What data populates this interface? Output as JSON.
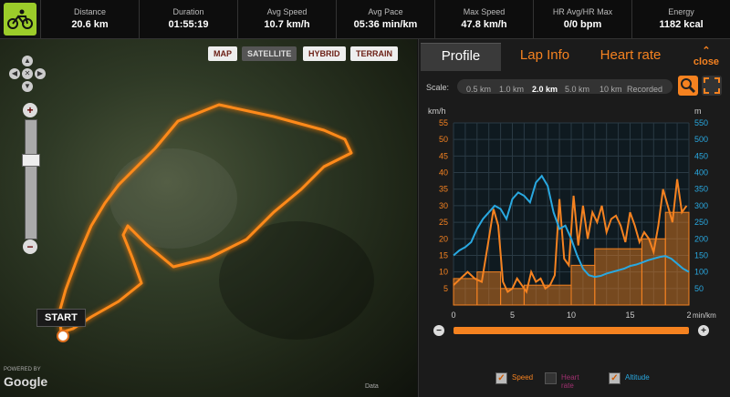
{
  "stats": [
    {
      "label": "Distance",
      "value": "20.6 km"
    },
    {
      "label": "Duration",
      "value": "01:55:19"
    },
    {
      "label": "Avg Speed",
      "value": "10.7 km/h"
    },
    {
      "label": "Avg Pace",
      "value": "05:36 min/km"
    },
    {
      "label": "Max Speed",
      "value": "47.8 km/h"
    },
    {
      "label": "HR Avg/HR Max",
      "value": "0/0 bpm"
    },
    {
      "label": "Energy",
      "value": "1182 kcal"
    }
  ],
  "map": {
    "types": [
      "MAP",
      "SATELLITE",
      "HYBRID",
      "TERRAIN"
    ],
    "selected_type": "SATELLITE",
    "start_label": "START",
    "powered_by": "POWERED BY",
    "brand": "Google",
    "copyright": "Data"
  },
  "panel": {
    "tabs": [
      "Profile",
      "Lap Info",
      "Heart rate"
    ],
    "selected_tab": "Profile",
    "close_label": "close",
    "scale_label": "Scale:",
    "scale_options": [
      "0.5 km",
      "1.0 km",
      "2.0 km",
      "5.0 km",
      "10 km",
      "Recorded"
    ],
    "selected_scale": "2.0 km"
  },
  "legend": [
    {
      "label": "Speed",
      "checked": true,
      "color": "#f58220"
    },
    {
      "label": "Heart rate",
      "checked": false,
      "color": "#a03070"
    },
    {
      "label": "Altitude",
      "checked": true,
      "color": "#29a8e0"
    }
  ],
  "chart_data": {
    "type": "line",
    "y_left_label": "km/h",
    "y_right_label": "m",
    "x_unit_label": "min/km",
    "y_left_ticks": [
      5,
      10,
      15,
      20,
      25,
      30,
      35,
      40,
      45,
      50,
      55
    ],
    "y_right_ticks": [
      50,
      100,
      150,
      200,
      250,
      300,
      350,
      400,
      450,
      500,
      550
    ],
    "x_ticks": [
      "0",
      "5",
      "10",
      "15",
      "2"
    ],
    "ylim_left": [
      0,
      55
    ],
    "ylim_right": [
      0,
      550
    ],
    "xlim": [
      0,
      20
    ],
    "speed_bars": [
      {
        "x0": 0,
        "x1": 2,
        "value": 8
      },
      {
        "x0": 2,
        "x1": 4,
        "value": 10
      },
      {
        "x0": 4,
        "x1": 6,
        "value": 5
      },
      {
        "x0": 6,
        "x1": 10,
        "value": 6
      },
      {
        "x0": 10,
        "x1": 12,
        "value": 12
      },
      {
        "x0": 12,
        "x1": 16,
        "value": 17
      },
      {
        "x0": 16,
        "x1": 18,
        "value": 20
      },
      {
        "x0": 18,
        "x1": 20,
        "value": 28
      }
    ],
    "series": [
      {
        "name": "Speed",
        "color": "#f58220",
        "x": [
          0,
          0.6,
          1.2,
          1.8,
          2.4,
          3.0,
          3.4,
          3.8,
          4.2,
          4.6,
          5.0,
          5.4,
          5.8,
          6.2,
          6.6,
          7.0,
          7.4,
          7.8,
          8.2,
          8.6,
          9.0,
          9.4,
          9.8,
          10.2,
          10.6,
          11.0,
          11.4,
          11.8,
          12.2,
          12.6,
          13.0,
          13.4,
          13.8,
          14.2,
          14.6,
          15.0,
          15.4,
          15.8,
          16.2,
          16.6,
          17.0,
          17.4,
          17.8,
          18.2,
          18.6,
          19.0,
          19.4,
          19.8
        ],
        "y": [
          6,
          8,
          10,
          8,
          7,
          20,
          29,
          24,
          7,
          4,
          5,
          8,
          6,
          4,
          10,
          7,
          8,
          5,
          6,
          9,
          32,
          14,
          12,
          33,
          18,
          30,
          20,
          28,
          25,
          30,
          22,
          26,
          27,
          24,
          19,
          28,
          24,
          19,
          22,
          20,
          16,
          24,
          35,
          30,
          25,
          38,
          28,
          30
        ]
      },
      {
        "name": "Altitude",
        "color": "#29a8e0",
        "x": [
          0,
          0.5,
          1.0,
          1.5,
          2.0,
          2.5,
          3.0,
          3.5,
          4.0,
          4.5,
          5.0,
          5.5,
          6.0,
          6.5,
          7.0,
          7.5,
          8.0,
          8.5,
          9.0,
          9.5,
          10.0,
          10.5,
          11.0,
          11.5,
          12.0,
          12.5,
          13.0,
          13.5,
          14.0,
          14.5,
          15.0,
          15.5,
          16.0,
          16.5,
          17.0,
          17.5,
          18.0,
          18.5,
          19.0,
          19.5,
          20.0
        ],
        "y": [
          150,
          165,
          175,
          190,
          230,
          260,
          280,
          300,
          290,
          260,
          320,
          340,
          330,
          310,
          370,
          390,
          360,
          280,
          230,
          240,
          200,
          150,
          110,
          90,
          85,
          88,
          95,
          100,
          105,
          110,
          118,
          122,
          128,
          135,
          140,
          145,
          148,
          140,
          125,
          110,
          100
        ]
      }
    ]
  }
}
